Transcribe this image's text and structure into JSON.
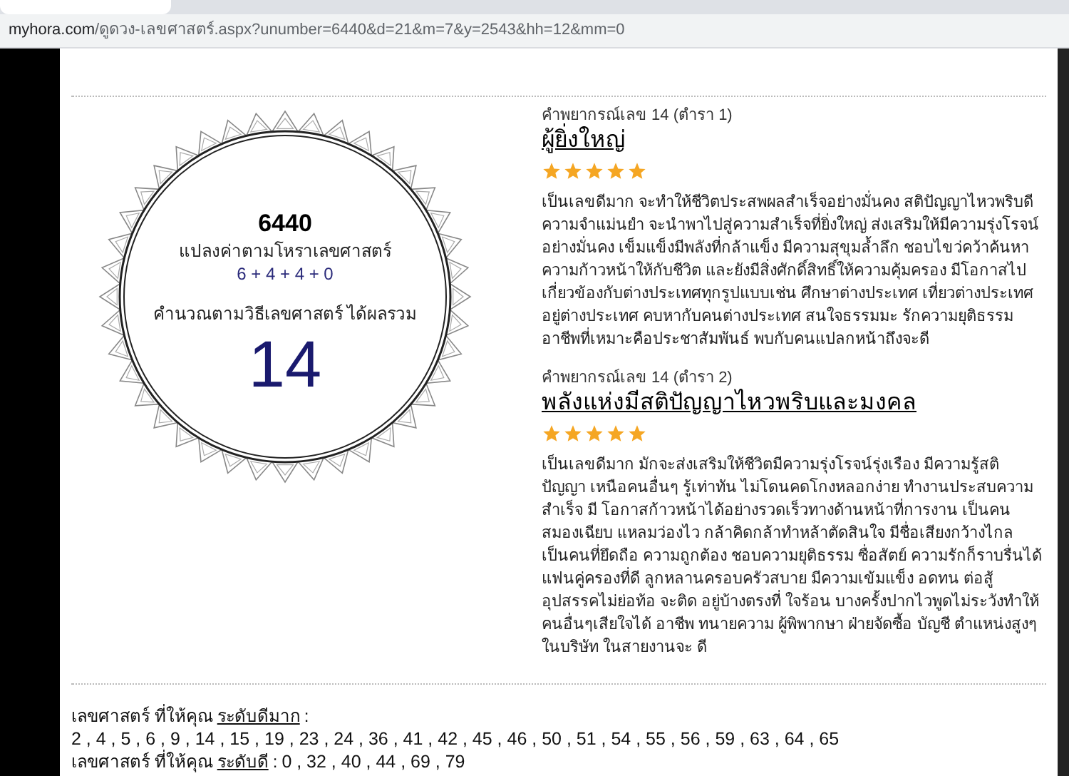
{
  "browser": {
    "url_host": "myhora.com",
    "url_path": "/ดูดวง-เลขศาสตร์.aspx?unumber=6440&d=21&m=7&y=2543&hh=12&mm=0"
  },
  "calculation": {
    "number": "6440",
    "convert_label": "แปลงค่าตามโหราเลขศาสตร์",
    "digits_sum": "6 + 4 + 4 + 0",
    "result_label": "คำนวณตามวิธีเลขศาสตร์ ได้ผลรวม",
    "result": "14"
  },
  "predictions": [
    {
      "source": "คำพยากรณ์เลข 14 (ตำรา 1)",
      "title": "ผู้ยิ่งใหญ่",
      "stars": 5,
      "text": "เป็นเลขดีมาก จะทำให้ชีวิตประสพผลสำเร็จอย่างมั่นคง สติปัญญาไหวพริบดี ความจำแม่นยำ จะนำพาไปสู่ความสำเร็จที่ยิ่งใหญ่ ส่งเสริมให้มีความรุ่งโรจน์ อย่างมั่นคง เข็มแข็งมีพลังที่กล้าแข็ง มีความสุขุมล้ำลึก ชอบไขว่คว้าค้นหา ความก้าวหน้าให้กับชีวิต และยังมีสิ่งศักดิ์สิทธิ์ให้ความคุ้มครอง มีโอกาสไป เกี่ยวข้องกับต่างประเทศทุกรูปแบบเช่น ศึกษาต่างประเทศ เที่ยวต่างประเทศ อยู่ต่างประเทศ คบหากับคนต่างประเทศ สนใจธรรมมะ รักความยุติธรรม อาชีพที่เหมาะคือประชาสัมพันธ์ พบกับคนแปลกหน้าถึงจะดี"
    },
    {
      "source": "คำพยากรณ์เลข 14 (ตำรา 2)",
      "title": "พลังแห่งมีสติปัญญาไหวพริบและมงคล",
      "stars": 5,
      "text": "เป็นเลขดีมาก มักจะส่งเสริมให้ชีวิตมีความรุ่งโรจน์รุ่งเรือง มีความรู้สติปัญญา เหนือคนอื่นๆ รู้เท่าทัน ไม่โดนคดโกงหลอกง่าย ทำงานประสบความสำเร็จ มี โอกาสก้าวหน้าได้อย่างรวดเร็วทางด้านหน้าที่การงาน เป็นคนสมองเฉียบ แหลมว่องไว กล้าคิดกล้าทำหล้าตัดสินใจ มีชื่อเสียงกว้างไกล เป็นคนที่ยึดถือ ความถูกต้อง ชอบความยุติธรรม ซื่อสัตย์ ความรักก็ราบรื่นได้แฟนคู่ครองที่ดี ลูกหลานครอบครัวสบาย มีความเข้มแข็ง อดทน ต่อสู้อุปสรรคไม่ย่อท้อ จะติด อยู่บ้างตรงที่ ใจร้อน บางครั้งปากไวพูดไม่ระวังทำให้คนอื่นๆเสียใจได้ อาชีพ ทนายความ ผู้พิพากษา ฝ่ายจัดซื้อ บัญชี ตำแหน่งสูงๆในบริษัท ในสายงานจะ ดี"
    }
  ],
  "lucky": [
    {
      "prefix": "เลขศาสตร์ ที่ให้คุณ",
      "level": "ระดับดีมาก",
      "suffix": ":",
      "numbers": "2 , 4 , 5 , 6 , 9 , 14 , 15 , 19 , 23 , 24 , 36 , 41 , 42 , 45 , 46 , 50 , 51 , 54 , 55 , 56 , 59 , 63 , 64 , 65",
      "kind": "block"
    },
    {
      "prefix": "เลขศาสตร์ ที่ให้คุณ",
      "level": "ระดับดี",
      "suffix": ":",
      "numbers": "0 , 32 , 40 , 44 , 69 , 79",
      "kind": "inline"
    }
  ]
}
